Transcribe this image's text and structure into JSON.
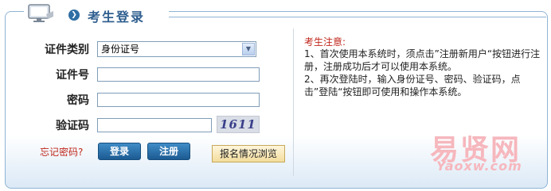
{
  "header": {
    "title": "考生登录"
  },
  "form": {
    "id_type_label": "证件类别",
    "id_type_value": "身份证号",
    "id_number_label": "证件号",
    "password_label": "密码",
    "captcha_label": "验证码",
    "captcha_text": "1611",
    "forgot_link": "忘记密码?",
    "login_button": "登录",
    "register_button": "注册",
    "browse_button": "报名情况浏览"
  },
  "notice": {
    "title": "考生注意:",
    "line1": "1、首次使用本系统时，须点击”注册新用户“按钮进行注册，注册成功后才可以使用本系统。",
    "line2": "2、再次登陆时，输入身份证号、密码、验证码，点击”登陆“按钮即可使用和操作本系统。"
  },
  "watermark": {
    "main": "易贤网",
    "sub": "Yaoxw.com"
  },
  "colors": {
    "title": "#2f5f8f",
    "notice_title": "#c0271c",
    "button": "#2a6da6"
  },
  "icons": [
    "monitor-icon",
    "arrow-circle-icon",
    "dropdown-arrow-icon"
  ]
}
